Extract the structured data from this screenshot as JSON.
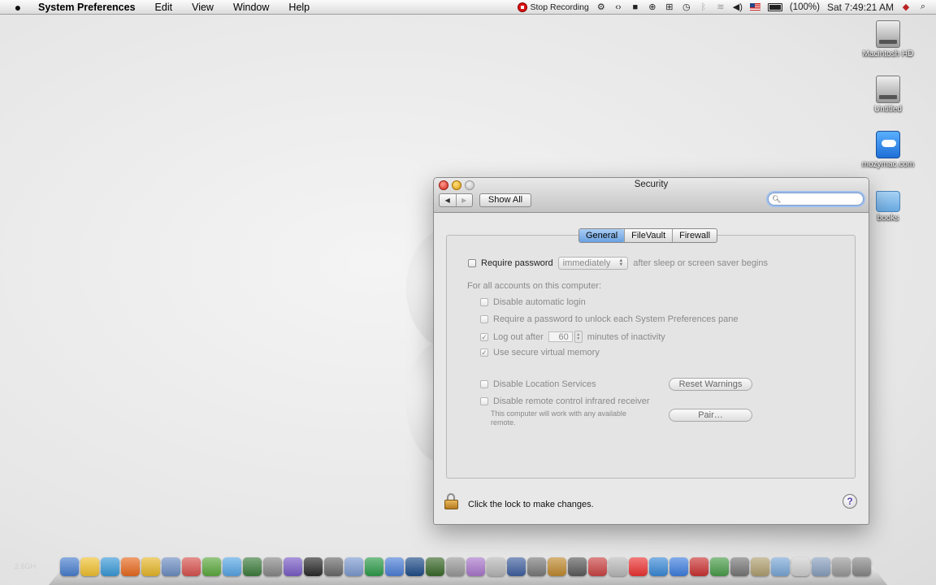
{
  "menubar": {
    "app_name": "System Preferences",
    "menus": [
      "Edit",
      "View",
      "Window",
      "Help"
    ],
    "status": {
      "recording_label": "Stop Recording",
      "battery": "(100%)",
      "clock": "Sat 7:49:21 AM"
    }
  },
  "desktop": {
    "icons": [
      {
        "label": "Macintosh HD"
      },
      {
        "label": "Untitled"
      },
      {
        "label": "mozymac.com"
      },
      {
        "label": "books"
      }
    ],
    "watermark": "2.6GH"
  },
  "window": {
    "title": "Security",
    "toolbar": {
      "show_all": "Show All",
      "back": "◀",
      "forward": "▶",
      "search_value": ""
    },
    "tabs": [
      "General",
      "FileVault",
      "Firewall"
    ],
    "active_tab": "General",
    "general": {
      "require_password_label": "Require password",
      "require_password_popup": "immediately",
      "require_password_suffix": "after sleep or screen saver begins",
      "all_accounts_heading": "For all accounts on this computer:",
      "disable_auto_login": "Disable automatic login",
      "require_password_unlock": "Require a password to unlock each System Preferences pane",
      "log_out_after": "Log out after",
      "log_out_minutes": "60",
      "log_out_suffix": "minutes of inactivity",
      "secure_vm": "Use secure virtual memory",
      "disable_location": "Disable Location Services",
      "reset_warnings": "Reset Warnings",
      "disable_infrared": "Disable remote control infrared receiver",
      "infrared_note": "This computer will work with any available remote.",
      "pair": "Pair…"
    },
    "footer": {
      "lock_text": "Click the lock to make changes.",
      "help": "?"
    }
  },
  "dock": {
    "icon_colors": [
      "#4a7fd0",
      "#f2c230",
      "#3a9ad9",
      "#e96a1f",
      "#e8b82a",
      "#6e8fc4",
      "#d9534f",
      "#5caa3e",
      "#58a6e6",
      "#3d7d3d",
      "#888888",
      "#7a5dc7",
      "#2b2b2b",
      "#6a6a6a",
      "#7d9bd1",
      "#2d9c4a",
      "#4d7fd8",
      "#1f4e8a",
      "#3a6a2a",
      "#9a9a9a",
      "#aa77cc",
      "#b8b8b8",
      "#4060a0",
      "#7a7a7a",
      "#c08a2e",
      "#5b5b5b",
      "#c44",
      "#bbbbbb",
      "#e33",
      "#3a8ad8",
      "#3f7fe0",
      "#c33",
      "#4a9d4a",
      "#777777",
      "#b0a070",
      "#7aa8d8",
      "#d0d0d0",
      "#8aa0c0",
      "#9a9a9a",
      "#888"
    ]
  }
}
